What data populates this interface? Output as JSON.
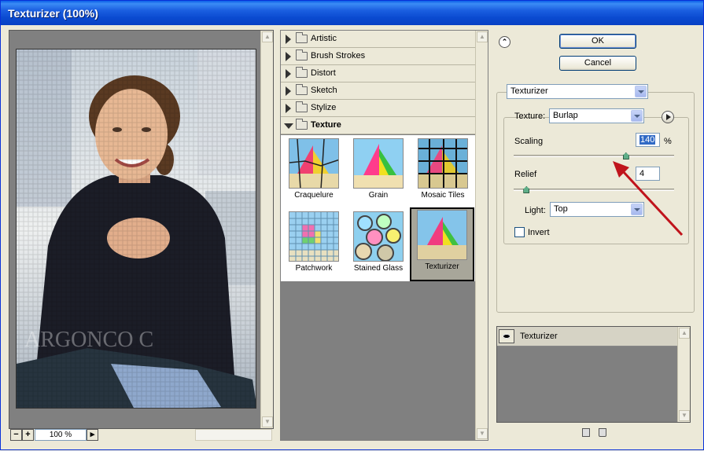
{
  "window": {
    "title": "Texturizer (100%)"
  },
  "preview": {
    "zoom_out": "−",
    "zoom_in": "+",
    "zoom_value": "100 %",
    "watermark": "ARGONCO C"
  },
  "filters": {
    "categories": [
      {
        "label": "Artistic",
        "expanded": false
      },
      {
        "label": "Brush Strokes",
        "expanded": false
      },
      {
        "label": "Distort",
        "expanded": false
      },
      {
        "label": "Sketch",
        "expanded": false
      },
      {
        "label": "Stylize",
        "expanded": false
      },
      {
        "label": "Texture",
        "expanded": true
      }
    ],
    "thumbnails": [
      {
        "label": "Craquelure"
      },
      {
        "label": "Grain"
      },
      {
        "label": "Mosaic Tiles"
      },
      {
        "label": "Patchwork"
      },
      {
        "label": "Stained Glass"
      },
      {
        "label": "Texturizer",
        "selected": true
      }
    ]
  },
  "actions": {
    "ok": "OK",
    "cancel": "Cancel"
  },
  "settings": {
    "filter_select": "Texturizer",
    "texture_label": "Texture:",
    "texture_value": "Burlap",
    "scaling_label": "Scaling",
    "scaling_value": "140",
    "scaling_unit": "%",
    "scaling_level": 0.7,
    "relief_label": "Relief",
    "relief_value": "4",
    "relief_level": 0.08,
    "light_label": "Light:",
    "light_value": "Top",
    "invert_label": "Invert",
    "invert_checked": false
  },
  "layers": {
    "items": [
      {
        "name": "Texturizer"
      }
    ]
  },
  "colors": {
    "titlebar": "#0a4ad0",
    "annotation_arrow": "#c0141c",
    "selected_text": "#316ac5"
  }
}
